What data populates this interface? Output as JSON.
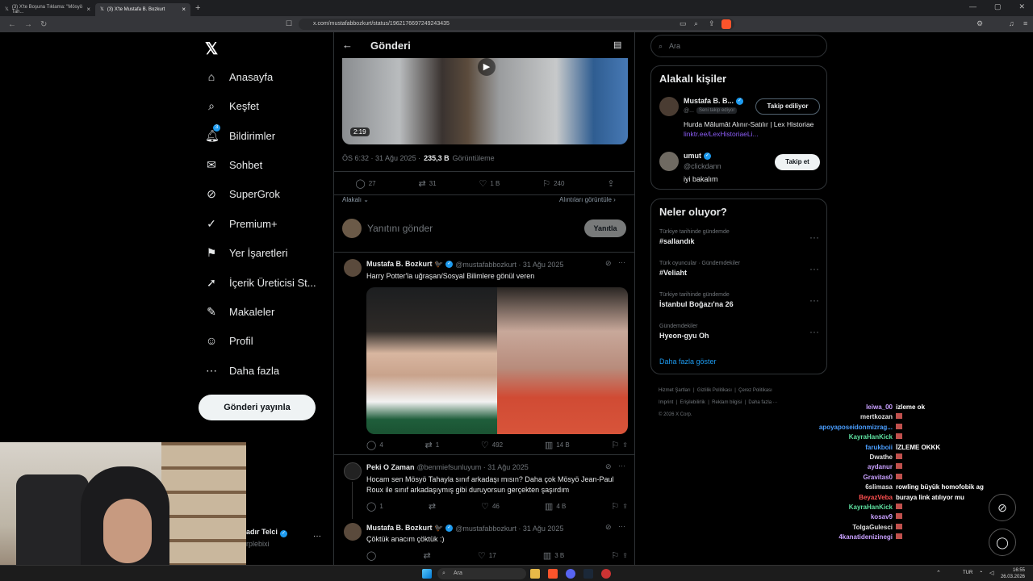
{
  "browser": {
    "tabs": [
      {
        "label": "(3) X'te Boşuna Tıklama: \"Mösyö Tah...",
        "active": false
      },
      {
        "label": "(3) X'te Mustafa B. Bozkurt",
        "active": true
      }
    ],
    "url": "x.com/mustafabbozkurt/status/1962176697249243435"
  },
  "nav": {
    "items": [
      {
        "label": "Anasayfa",
        "icon": "home-icon"
      },
      {
        "label": "Keşfet",
        "icon": "search-icon"
      },
      {
        "label": "Bildirimler",
        "icon": "bell-icon"
      },
      {
        "label": "Sohbet",
        "icon": "mail-icon"
      },
      {
        "label": "SuperGrok",
        "icon": "grok-icon"
      },
      {
        "label": "Premium+",
        "icon": "premium-icon"
      },
      {
        "label": "Yer İşaretleri",
        "icon": "bookmark-icon"
      },
      {
        "label": "İçerik Üreticisi St...",
        "icon": "rocket-icon"
      },
      {
        "label": "Makaleler",
        "icon": "article-icon"
      },
      {
        "label": "Profil",
        "icon": "person-icon"
      },
      {
        "label": "Daha fazla",
        "icon": "more-circle-icon"
      }
    ],
    "notif_badge": "3",
    "post_button": "Gönderi yayınla",
    "account_name": "adır Telci",
    "account_handle": "rplebixi"
  },
  "header": {
    "title": "Gönderi"
  },
  "post": {
    "video_duration": "2:19",
    "timestamp": "ÖS 6:32 · 31 Ağu 2025 ·",
    "views": "235,3 B",
    "views_label": "Görüntüleme",
    "replies": "27",
    "reposts": "31",
    "likes": "1 B",
    "bookmarks": "240",
    "sort": "Alakalı",
    "quotes_link": "Alıntıları görüntüle"
  },
  "reply_box": {
    "placeholder": "Yanıtını gönder",
    "button": "Yanıtla"
  },
  "replies": [
    {
      "name": "Mustafa B. Bozkurt 🐦‍⬛",
      "handle": "@mustafabbozkurt · 31 Ağu 2025",
      "text": "Harry Potter'la uğraşan/Sosyal Bilimlere gönül veren",
      "replies": "4",
      "reposts": "1",
      "likes": "492",
      "views": "14 B"
    },
    {
      "name": "Peki O Zaman",
      "handle": "@benmiefsunluyum · 31 Ağu 2025",
      "text": "Hocam sen Mösyö Tahayla sınıf arkadaşı mısın? Daha çok Mösyö Jean-Paul Roux ile sınıf arkadaşıymış gibi duruyorsun gerçekten şaşırdım",
      "replies": "1",
      "reposts": "",
      "likes": "46",
      "views": "4 B"
    },
    {
      "name": "Mustafa B. Bozkurt 🐦‍⬛",
      "handle": "@mustafabbozkurt · 31 Ağu 2025",
      "text": "Çöktük anacım çöktük :)",
      "replies": "",
      "reposts": "",
      "likes": "17",
      "views": "3 B"
    }
  ],
  "sidebar": {
    "search_placeholder": "Ara",
    "people_title": "Alakalı kişiler",
    "people": [
      {
        "name": "Mustafa B. B...",
        "handle": "@...",
        "follows_you": "Seni takip ediyor",
        "bio": "Hurda Mâlumât Alınır-Satılır | Lex Historiae",
        "bio_link": "linktr.ee/LexHistoriaeLi...",
        "button": "Takip ediliyor"
      },
      {
        "name": "umut",
        "handle": "@clickdann",
        "bio": "iyi bakalım",
        "button": "Takip et"
      }
    ],
    "trends_title": "Neler oluyor?",
    "trends": [
      {
        "meta": "Türkiye tarihinde gündemde",
        "name": "#sallandık"
      },
      {
        "meta": "Türk oyuncular · Gündemdekiler",
        "name": "#Veliaht"
      },
      {
        "meta": "Türkiye tarihinde gündemde",
        "name": "İstanbul Boğazı'na 26"
      },
      {
        "meta": "Gündemdekiler",
        "name": "Hyeon-gyu Oh"
      }
    ],
    "show_more": "Daha fazla göster",
    "footer": [
      "Hizmet Şartları",
      "Gizlilik Politikası",
      "Çerez Politikası",
      "Imprint",
      "Erişilebilirlik",
      "Reklam bilgisi",
      "Daha fazla ···",
      "© 2026 X Corp."
    ]
  },
  "chat": [
    {
      "user": "leiwa_00",
      "msg": "izleme ok",
      "color": "#c9a0ff"
    },
    {
      "user": "mertkozan",
      "msg": "",
      "color": "#e0e0e0"
    },
    {
      "user": "apoyaposeidonmizrag...",
      "msg": "",
      "color": "#4a9eff"
    },
    {
      "user": "KayraHanKick",
      "msg": "",
      "color": "#5ee0a0"
    },
    {
      "user": "farukboii",
      "msg": "İZLEME OKKK",
      "color": "#4a9eff"
    },
    {
      "user": "Dwathe",
      "msg": "",
      "color": "#e0e0e0"
    },
    {
      "user": "aydanur",
      "msg": "",
      "color": "#c9a0ff"
    },
    {
      "user": "Gravitas0",
      "msg": "",
      "color": "#c9a0ff"
    },
    {
      "user": "6slimasa",
      "msg": "rowling büyük homofobik ag",
      "color": "#e0e0e0"
    },
    {
      "user": "BeyazVeba",
      "msg": "buraya link atılıyor mu",
      "color": "#ff5050"
    },
    {
      "user": "KayraHanKick",
      "msg": "",
      "color": "#5ee0a0"
    },
    {
      "user": "kosav9",
      "msg": "",
      "color": "#c9a0ff"
    },
    {
      "user": "TolgaGulesci",
      "msg": "",
      "color": "#e0e0e0"
    },
    {
      "user": "4kanatidenizinegi",
      "msg": "",
      "color": "#c9a0ff"
    }
  ],
  "taskbar": {
    "search": "Ara",
    "lang": "TUR",
    "time": "16:55",
    "date": "26.03.2026"
  }
}
